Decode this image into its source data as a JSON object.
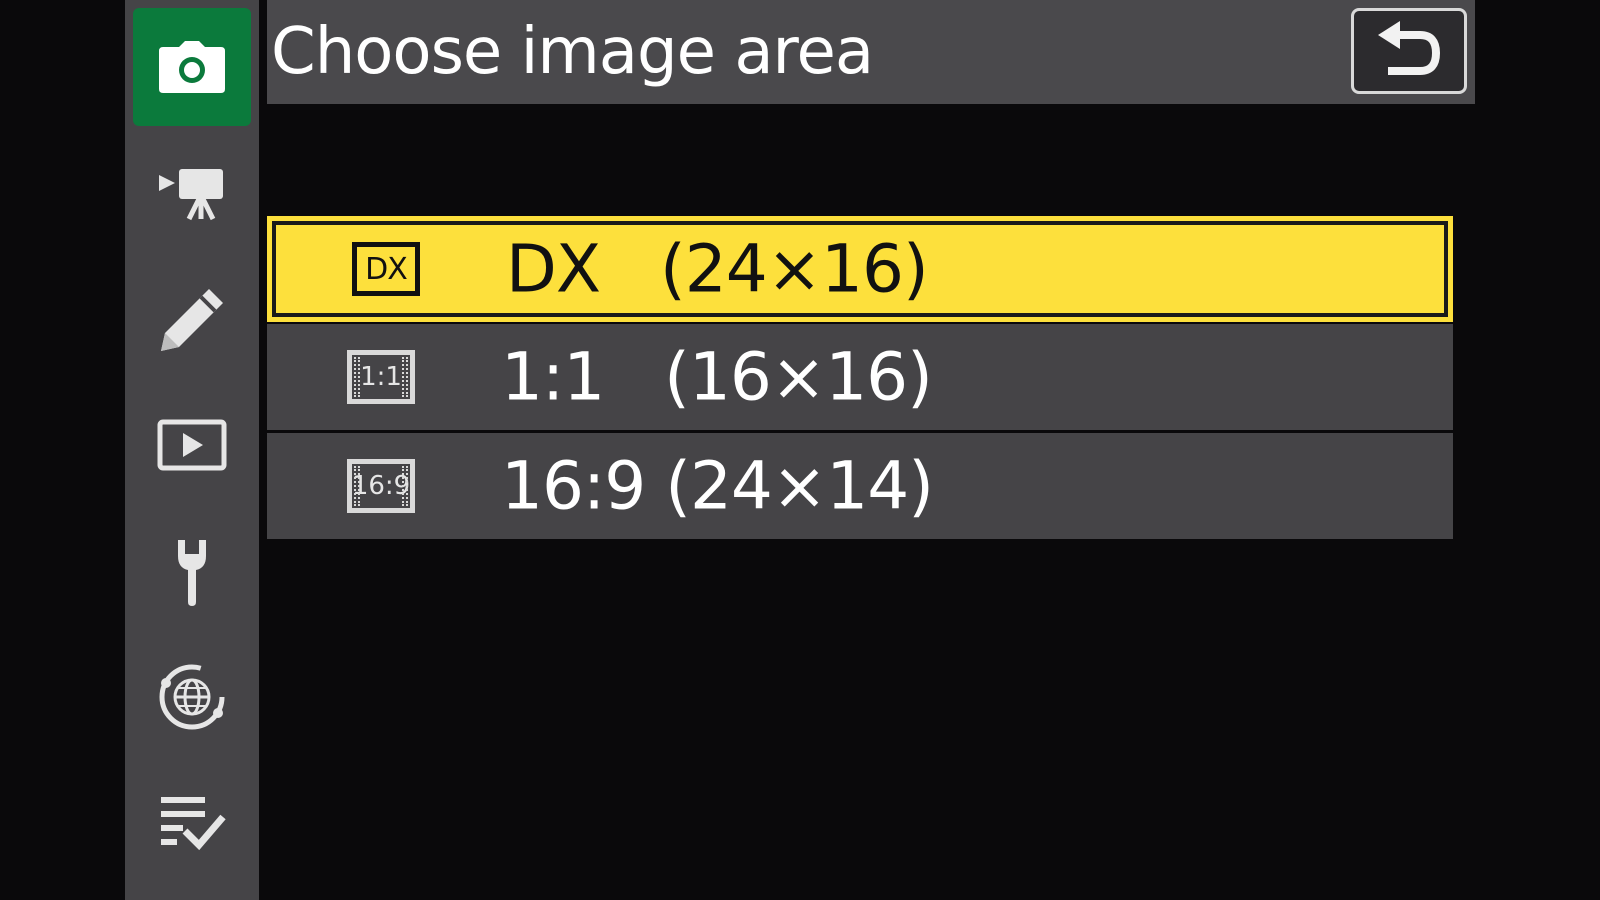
{
  "header": {
    "title": "Choose image area"
  },
  "sidebar": {
    "tabs": [
      {
        "name": "photo-shooting-menu",
        "icon": "camera-icon",
        "active": true
      },
      {
        "name": "movie-recording-menu",
        "icon": "movie-camera-icon",
        "active": false
      },
      {
        "name": "custom-settings-menu",
        "icon": "pencil-icon",
        "active": false
      },
      {
        "name": "playback-menu",
        "icon": "play-icon",
        "active": false
      },
      {
        "name": "setup-menu",
        "icon": "wrench-icon",
        "active": false
      },
      {
        "name": "network-menu",
        "icon": "globe-network-icon",
        "active": false
      },
      {
        "name": "my-menu",
        "icon": "checklist-icon",
        "active": false
      }
    ]
  },
  "options": [
    {
      "icon_text": "DX",
      "label": "DX   (24×16)",
      "selected": true
    },
    {
      "icon_text": "1:1",
      "label": "1:1   (16×16)",
      "selected": false
    },
    {
      "icon_text": "16:9",
      "label": "16:9 (24×14)",
      "selected": false
    }
  ],
  "colors": {
    "selection": "#fde03c",
    "active_tab": "#0b7a3c",
    "rail": "#454447",
    "background": "#0a090b"
  }
}
